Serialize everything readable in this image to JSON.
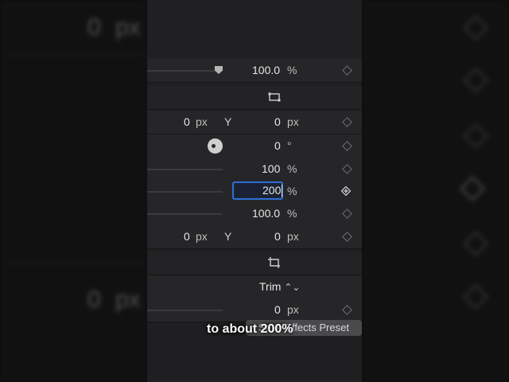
{
  "background_echo": {
    "left_top_value": "0",
    "left_top_unit": "px",
    "left_bottom_value": "0",
    "left_bottom_unit": "px"
  },
  "inspector": {
    "opacity_row": {
      "value": "100.0",
      "unit": "%"
    },
    "position_row": {
      "x_value": "0",
      "x_unit": "px",
      "y_label": "Y",
      "y_value": "0",
      "y_unit": "px"
    },
    "rotation_row": {
      "value": "0",
      "unit": "°"
    },
    "scale_all_row": {
      "value": "100",
      "unit": "%"
    },
    "scale_x_row": {
      "value": "200",
      "unit": "%"
    },
    "scale_y_row": {
      "value": "100.0",
      "unit": "%"
    },
    "anchor_row": {
      "x_value": "0",
      "x_unit": "px",
      "y_label": "Y",
      "y_value": "0",
      "y_unit": "px"
    },
    "crop_row": {
      "type_label": "Trim",
      "chevron": "⌃⌄"
    },
    "crop_left_row": {
      "value": "0",
      "unit": "px"
    }
  },
  "preset_button": {
    "label": "Save Effects Preset"
  },
  "caption": {
    "text": "to about 200%"
  },
  "colors": {
    "panel_bg": "#262628",
    "focus_ring": "#2f6fd6",
    "text": "#e6e6e6"
  },
  "icons": [
    "transform-icon",
    "crop-icon",
    "keyframe-diamond-icon",
    "add-keyframe-icon",
    "rotation-dial-icon",
    "slider-knob-icon",
    "chevron-updown-icon"
  ]
}
